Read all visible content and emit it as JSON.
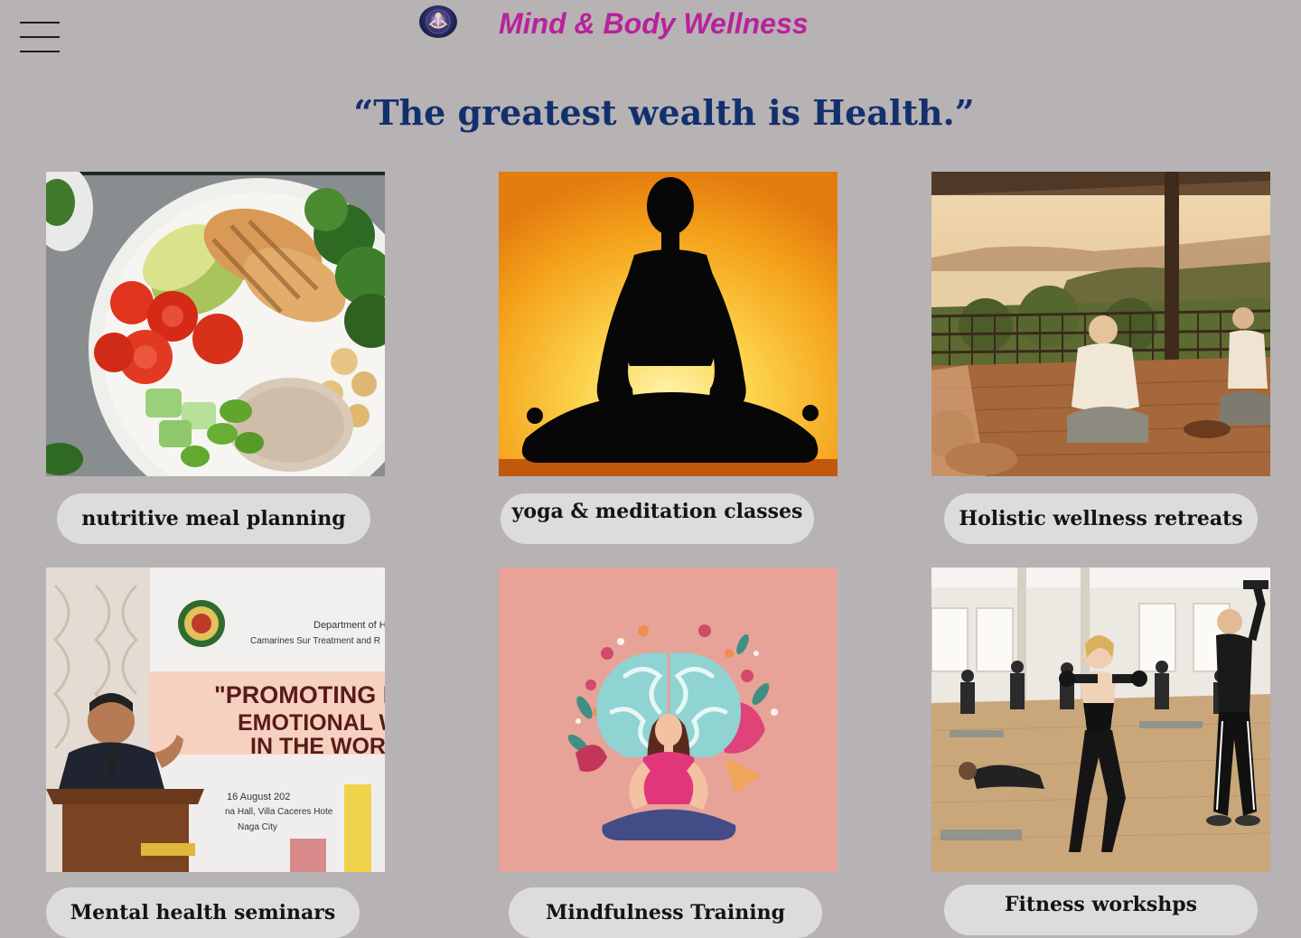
{
  "header": {
    "menu_icon": "hamburger-menu-icon",
    "logo_icon": "meditation-logo-icon",
    "brand": "Mind & Body Wellness"
  },
  "quote": "“The greatest wealth is Health.”",
  "services": [
    {
      "label": "nutritive meal planning",
      "image": "healthy-food-bowl"
    },
    {
      "label": "yoga & meditation classes",
      "image": "yoga-silhouette-sunset"
    },
    {
      "label": "Holistic wellness retreats",
      "image": "retreat-meditation-terrace"
    },
    {
      "label": "Mental health seminars",
      "image": "mental-health-seminar-speaker"
    },
    {
      "label": "Mindfulness Training",
      "image": "mindfulness-brain-illustration"
    },
    {
      "label": "Fitness workshps",
      "image": "fitness-class-dumbbells"
    }
  ],
  "seminar_banner": {
    "department": "Department of He",
    "facility": "Camarines Sur Treatment and R",
    "line1": "\"PROMOTING ME",
    "line2": "EMOTIONAL W",
    "line3": "IN THE WORK",
    "date": "16 August 202",
    "venue": "na Hall, Villa Caceres Hote",
    "city": "Naga City"
  }
}
